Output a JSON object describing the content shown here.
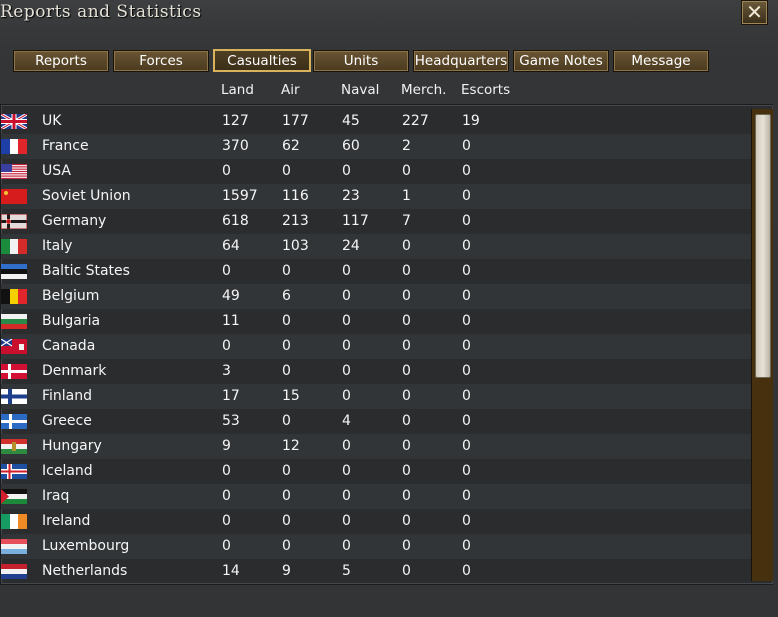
{
  "window": {
    "title": "Reports and Statistics",
    "close_symbol": "✕"
  },
  "tabs": [
    {
      "label": "Reports",
      "active": false
    },
    {
      "label": "Forces",
      "active": false
    },
    {
      "label": "Casualties",
      "active": true
    },
    {
      "label": "Units",
      "active": false
    },
    {
      "label": "Headquarters",
      "active": false
    },
    {
      "label": "Game Notes",
      "active": false
    },
    {
      "label": "Message",
      "active": false
    }
  ],
  "columns": [
    "Land",
    "Air",
    "Naval",
    "Merch.",
    "Escorts"
  ],
  "rows": [
    {
      "country": "UK",
      "flag": "uk-flag-icon",
      "land": "127",
      "air": "177",
      "naval": "45",
      "merch": "227",
      "escorts": "19"
    },
    {
      "country": "France",
      "flag": "france-flag-icon",
      "land": "370",
      "air": "62",
      "naval": "60",
      "merch": "2",
      "escorts": "0"
    },
    {
      "country": "USA",
      "flag": "usa-flag-icon",
      "land": "0",
      "air": "0",
      "naval": "0",
      "merch": "0",
      "escorts": "0"
    },
    {
      "country": "Soviet Union",
      "flag": "soviet-union-flag-icon",
      "land": "1597",
      "air": "116",
      "naval": "23",
      "merch": "1",
      "escorts": "0"
    },
    {
      "country": "Germany",
      "flag": "germany-flag-icon",
      "land": "618",
      "air": "213",
      "naval": "117",
      "merch": "7",
      "escorts": "0"
    },
    {
      "country": "Italy",
      "flag": "italy-flag-icon",
      "land": "64",
      "air": "103",
      "naval": "24",
      "merch": "0",
      "escorts": "0"
    },
    {
      "country": "Baltic States",
      "flag": "baltic-states-flag-icon",
      "land": "0",
      "air": "0",
      "naval": "0",
      "merch": "0",
      "escorts": "0"
    },
    {
      "country": "Belgium",
      "flag": "belgium-flag-icon",
      "land": "49",
      "air": "6",
      "naval": "0",
      "merch": "0",
      "escorts": "0"
    },
    {
      "country": "Bulgaria",
      "flag": "bulgaria-flag-icon",
      "land": "11",
      "air": "0",
      "naval": "0",
      "merch": "0",
      "escorts": "0"
    },
    {
      "country": "Canada",
      "flag": "canada-flag-icon",
      "land": "0",
      "air": "0",
      "naval": "0",
      "merch": "0",
      "escorts": "0"
    },
    {
      "country": "Denmark",
      "flag": "denmark-flag-icon",
      "land": "3",
      "air": "0",
      "naval": "0",
      "merch": "0",
      "escorts": "0"
    },
    {
      "country": "Finland",
      "flag": "finland-flag-icon",
      "land": "17",
      "air": "15",
      "naval": "0",
      "merch": "0",
      "escorts": "0"
    },
    {
      "country": "Greece",
      "flag": "greece-flag-icon",
      "land": "53",
      "air": "0",
      "naval": "4",
      "merch": "0",
      "escorts": "0"
    },
    {
      "country": "Hungary",
      "flag": "hungary-flag-icon",
      "land": "9",
      "air": "12",
      "naval": "0",
      "merch": "0",
      "escorts": "0"
    },
    {
      "country": "Iceland",
      "flag": "iceland-flag-icon",
      "land": "0",
      "air": "0",
      "naval": "0",
      "merch": "0",
      "escorts": "0"
    },
    {
      "country": "Iraq",
      "flag": "iraq-flag-icon",
      "land": "0",
      "air": "0",
      "naval": "0",
      "merch": "0",
      "escorts": "0"
    },
    {
      "country": "Ireland",
      "flag": "ireland-flag-icon",
      "land": "0",
      "air": "0",
      "naval": "0",
      "merch": "0",
      "escorts": "0"
    },
    {
      "country": "Luxembourg",
      "flag": "luxembourg-flag-icon",
      "land": "0",
      "air": "0",
      "naval": "0",
      "merch": "0",
      "escorts": "0"
    },
    {
      "country": "Netherlands",
      "flag": "netherlands-flag-icon",
      "land": "14",
      "air": "9",
      "naval": "5",
      "merch": "0",
      "escorts": "0"
    }
  ]
}
